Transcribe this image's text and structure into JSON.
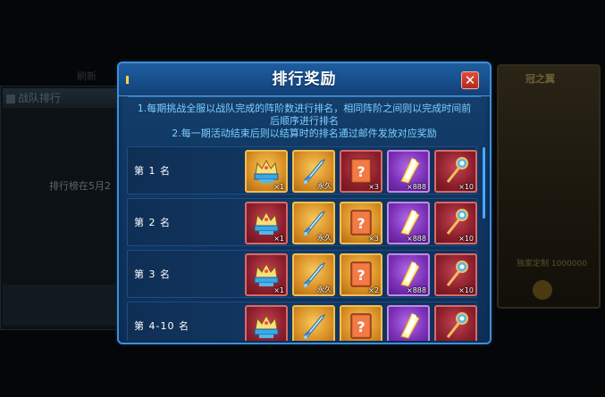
{
  "background": {
    "left_panel_title": "战队排行",
    "left_panel_text": "排行榜在5月2",
    "top_label": "刷新",
    "right_card_title": "冠之翼",
    "right_card_footer": "独家定制  1000000"
  },
  "modal": {
    "title": "排行奖励",
    "close_label": "✕",
    "description": [
      "1.每期挑战全服以战队完成的阵阶数进行排名，相同阵阶之间则以完成时间前",
      "后顺序进行排名",
      "2.每一期活动结束后则以结算时的排名通过邮件发放对应奖励"
    ],
    "rows": [
      {
        "rank": "第 1 名",
        "items": [
          {
            "icon": "crown-icon",
            "count": "×1",
            "rarity": "gold"
          },
          {
            "icon": "sword-icon",
            "count": "永久",
            "rarity": "gold"
          },
          {
            "icon": "mystery-book-icon",
            "count": "×3",
            "rarity": "red"
          },
          {
            "icon": "crystal-shard-icon",
            "count": "×888",
            "rarity": "purple"
          },
          {
            "icon": "magic-staff-icon",
            "count": "×10",
            "rarity": "red"
          }
        ]
      },
      {
        "rank": "第 2 名",
        "items": [
          {
            "icon": "crown-icon",
            "count": "×1",
            "rarity": "red"
          },
          {
            "icon": "sword-icon",
            "count": "永久",
            "rarity": "gold"
          },
          {
            "icon": "mystery-book-icon",
            "count": "×3",
            "rarity": "gold"
          },
          {
            "icon": "crystal-shard-icon",
            "count": "×888",
            "rarity": "purple"
          },
          {
            "icon": "magic-staff-icon",
            "count": "×10",
            "rarity": "red"
          }
        ]
      },
      {
        "rank": "第 3 名",
        "items": [
          {
            "icon": "crown-icon",
            "count": "×1",
            "rarity": "red"
          },
          {
            "icon": "sword-icon",
            "count": "永久",
            "rarity": "gold"
          },
          {
            "icon": "mystery-book-icon",
            "count": "×2",
            "rarity": "gold"
          },
          {
            "icon": "crystal-shard-icon",
            "count": "×888",
            "rarity": "purple"
          },
          {
            "icon": "magic-staff-icon",
            "count": "×10",
            "rarity": "red"
          }
        ]
      },
      {
        "rank": "第 4-10 名",
        "items": [
          {
            "icon": "crown-icon",
            "count": "",
            "rarity": "red"
          },
          {
            "icon": "sword-icon",
            "count": "",
            "rarity": "gold"
          },
          {
            "icon": "mystery-book-icon",
            "count": "",
            "rarity": "gold"
          },
          {
            "icon": "crystal-shard-icon",
            "count": "",
            "rarity": "purple"
          },
          {
            "icon": "magic-staff-icon",
            "count": "",
            "rarity": "red"
          }
        ]
      }
    ]
  },
  "colors": {
    "modal_bg": "#103561",
    "modal_border": "#3f8fd8",
    "description_text": "#7dd0ff",
    "close_button": "#c8382a"
  }
}
